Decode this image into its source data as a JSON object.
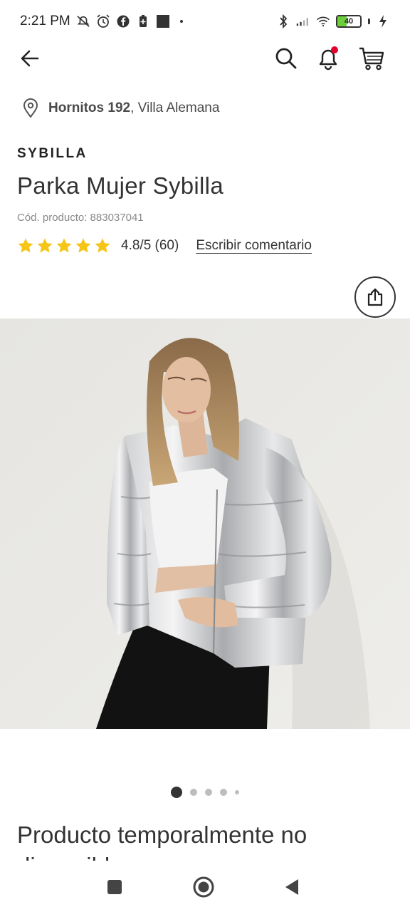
{
  "status_bar": {
    "time": "2:21 PM",
    "battery_level": "40",
    "battery_fraction": 0.4
  },
  "icons": {
    "back": "arrow-left-icon",
    "search": "search-icon",
    "notifications": "bell-icon",
    "cart": "cart-icon",
    "location": "location-pin-icon",
    "share": "share-icon"
  },
  "colors": {
    "star": "#f5c518",
    "notification_dot": "#e4002b",
    "text": "#333333",
    "muted": "#888888"
  },
  "location": {
    "street": "Hornitos 192",
    "city": ", Villa Alemana"
  },
  "product": {
    "brand": "SYBILLA",
    "title": "Parka Mujer Sybilla",
    "code": "Cód. producto: 883037041",
    "rating_value": 4.8,
    "rating_text": "4.8/5 (60)",
    "review_link": "Escribir comentario",
    "stars": 5
  },
  "carousel": {
    "total": 5,
    "active_index": 0
  },
  "availability": {
    "message": "Producto temporalmente no disponible"
  },
  "system_nav": {
    "recents": "square-icon",
    "home": "circle-icon",
    "back": "triangle-back-icon"
  }
}
